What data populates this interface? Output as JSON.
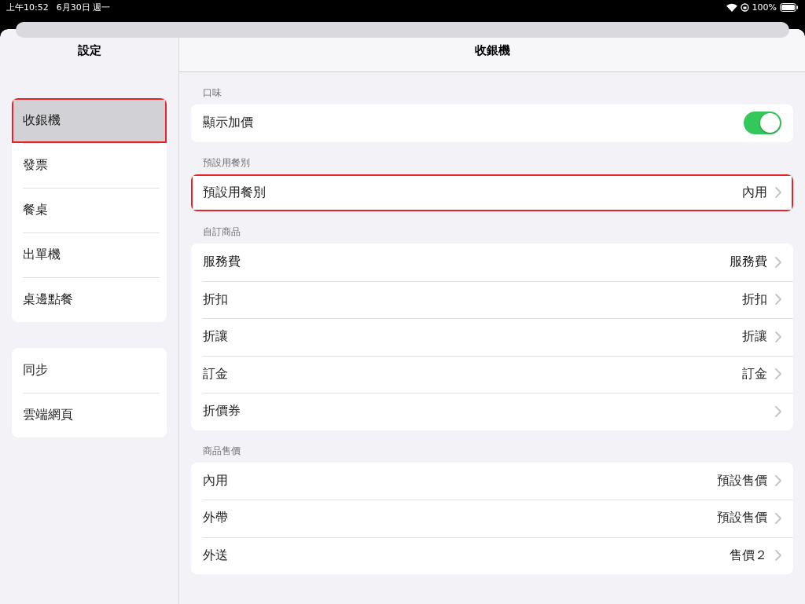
{
  "status_bar": {
    "time": "上午10:52",
    "date": "6月30日 週一",
    "battery": "100%"
  },
  "sidebar": {
    "title": "設定",
    "groups": [
      [
        {
          "label": "收銀機",
          "selected": true,
          "highlighted": true
        },
        {
          "label": "發票",
          "selected": false,
          "highlighted": false
        },
        {
          "label": "餐桌",
          "selected": false,
          "highlighted": false
        },
        {
          "label": "出單機",
          "selected": false,
          "highlighted": false
        },
        {
          "label": "桌邊點餐",
          "selected": false,
          "highlighted": false
        }
      ],
      [
        {
          "label": "同步",
          "selected": false,
          "highlighted": false
        },
        {
          "label": "雲端網頁",
          "selected": false,
          "highlighted": false
        }
      ]
    ]
  },
  "main": {
    "title": "收銀機",
    "sections": [
      {
        "header": "口味",
        "rows": [
          {
            "kind": "toggle",
            "label": "顯示加價",
            "on": true,
            "highlighted": false
          }
        ]
      },
      {
        "header": "預設用餐別",
        "rows": [
          {
            "kind": "link",
            "label": "預設用餐別",
            "value": "內用",
            "highlighted": true
          }
        ]
      },
      {
        "header": "自訂商品",
        "rows": [
          {
            "kind": "link",
            "label": "服務費",
            "value": "服務費",
            "highlighted": false
          },
          {
            "kind": "link",
            "label": "折扣",
            "value": "折扣",
            "highlighted": false
          },
          {
            "kind": "link",
            "label": "折讓",
            "value": "折讓",
            "highlighted": false
          },
          {
            "kind": "link",
            "label": "訂金",
            "value": "訂金",
            "highlighted": false
          },
          {
            "kind": "link",
            "label": "折價券",
            "highlighted": false
          }
        ]
      },
      {
        "header": "商品售價",
        "rows": [
          {
            "kind": "link",
            "label": "內用",
            "value": "預設售價",
            "highlighted": false
          },
          {
            "kind": "link",
            "label": "外帶",
            "value": "預設售價",
            "highlighted": false
          },
          {
            "kind": "link",
            "label": "外送",
            "value": "售價２",
            "highlighted": false
          }
        ]
      }
    ]
  }
}
